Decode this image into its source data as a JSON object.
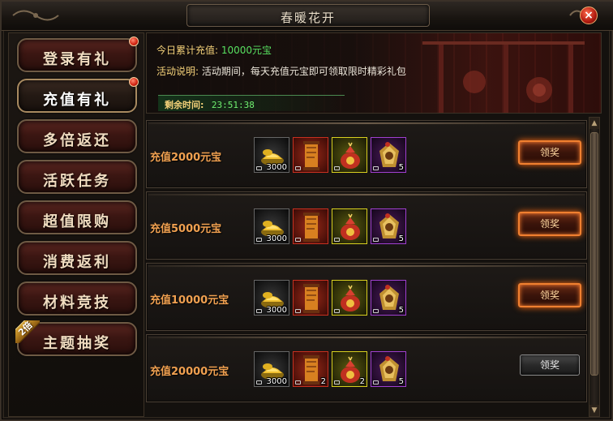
{
  "window": {
    "title": "春暖花开",
    "close_label": "×"
  },
  "sidebar": {
    "items": [
      {
        "label": "登录有礼",
        "badge_dot": true,
        "tag": ""
      },
      {
        "label": "充值有礼",
        "badge_dot": true,
        "tag": "",
        "active": true
      },
      {
        "label": "多倍返还",
        "badge_dot": false,
        "tag": ""
      },
      {
        "label": "活跃任务",
        "badge_dot": false,
        "tag": ""
      },
      {
        "label": "超值限购",
        "badge_dot": false,
        "tag": ""
      },
      {
        "label": "消费返利",
        "badge_dot": false,
        "tag": ""
      },
      {
        "label": "材料竞技",
        "badge_dot": false,
        "tag": ""
      },
      {
        "label": "主题抽奖",
        "badge_dot": false,
        "tag": "2倍"
      }
    ]
  },
  "header": {
    "total_label": "今日累计充值:",
    "total_value": "10000元宝",
    "desc_label": "活动说明:",
    "desc_value": "活动期间，每天充值元宝即可领取限时精彩礼包",
    "timer_label": "剩余时间:",
    "timer_value": "23:51:38"
  },
  "rows": [
    {
      "label": "充值2000元宝",
      "items": [
        {
          "icon": "gold-ingot-icon",
          "count": "3000"
        },
        {
          "icon": "scroll-icon",
          "count": ""
        },
        {
          "icon": "red-bag-icon",
          "count": ""
        },
        {
          "icon": "purple-token-icon",
          "count": "5"
        }
      ],
      "button": "领奖",
      "enabled": true
    },
    {
      "label": "充值5000元宝",
      "items": [
        {
          "icon": "gold-ingot-icon",
          "count": "3000"
        },
        {
          "icon": "scroll-icon",
          "count": ""
        },
        {
          "icon": "red-bag-icon",
          "count": ""
        },
        {
          "icon": "purple-token-icon",
          "count": "5"
        }
      ],
      "button": "领奖",
      "enabled": true
    },
    {
      "label": "充值10000元宝",
      "items": [
        {
          "icon": "gold-ingot-icon",
          "count": "3000"
        },
        {
          "icon": "scroll-icon",
          "count": ""
        },
        {
          "icon": "red-bag-icon",
          "count": ""
        },
        {
          "icon": "purple-token-icon",
          "count": "5"
        }
      ],
      "button": "领奖",
      "enabled": true
    },
    {
      "label": "充值20000元宝",
      "items": [
        {
          "icon": "gold-ingot-icon",
          "count": "3000"
        },
        {
          "icon": "scroll-icon",
          "count": "2"
        },
        {
          "icon": "red-bag-icon",
          "count": "2"
        },
        {
          "icon": "purple-token-icon",
          "count": "5"
        }
      ],
      "button": "领奖",
      "enabled": false
    }
  ],
  "colors": {
    "accent_orange": "#f08030",
    "label_yellow": "#f5d27a",
    "value_green": "#58e060",
    "row_label": "#f0a050"
  }
}
